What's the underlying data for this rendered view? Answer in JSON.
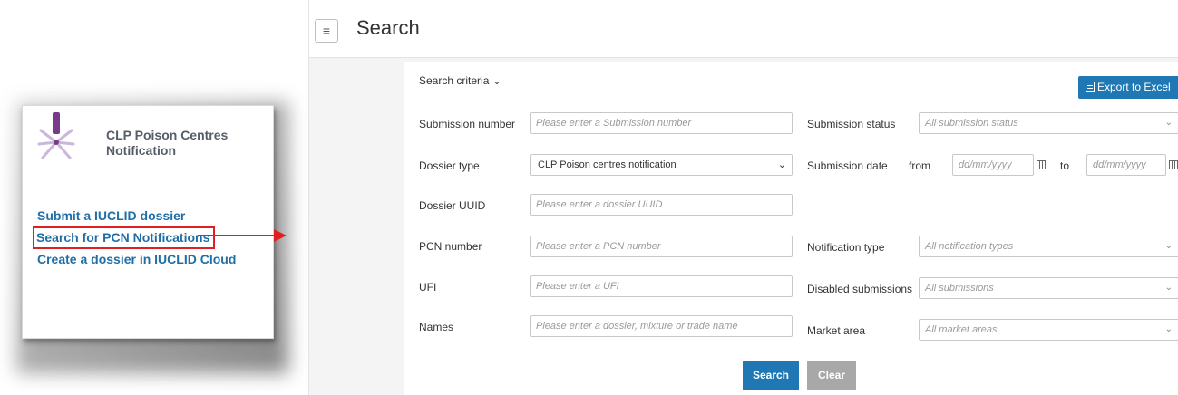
{
  "card": {
    "title": "CLP Poison Centres Notification",
    "links": [
      {
        "label": "Submit a IUCLID dossier"
      },
      {
        "label": "Search for PCN Notifications"
      },
      {
        "label": "Create a dossier in IUCLID Cloud"
      }
    ]
  },
  "header": {
    "title": "Search"
  },
  "search": {
    "criteria_label": "Search criteria",
    "export_label": "Export to Excel",
    "fields": {
      "submission_number": {
        "label": "Submission number",
        "placeholder": "Please enter a Submission number"
      },
      "submission_status": {
        "label": "Submission status",
        "value": "All submission status"
      },
      "dossier_type": {
        "label": "Dossier type",
        "value": "CLP Poison centres notification"
      },
      "submission_date": {
        "label": "Submission date",
        "from_label": "from",
        "to_label": "to",
        "from_placeholder": "dd/mm/yyyy",
        "to_placeholder": "dd/mm/yyyy"
      },
      "dossier_uuid": {
        "label": "Dossier UUID",
        "placeholder": "Please enter a dossier UUID"
      },
      "pcn_number": {
        "label": "PCN number",
        "placeholder": "Please enter a PCN number"
      },
      "notification_type": {
        "label": "Notification type",
        "value": "All notification types"
      },
      "ufi": {
        "label": "UFI",
        "placeholder": "Please enter a UFI"
      },
      "disabled_submissions": {
        "label": "Disabled submissions",
        "value": "All submissions"
      },
      "names": {
        "label": "Names",
        "placeholder": "Please enter a dossier, mixture or trade name"
      },
      "market_area": {
        "label": "Market area",
        "value": "All market areas"
      }
    },
    "search_button": "Search",
    "clear_button": "Clear"
  },
  "colors": {
    "accent": "#1f78b4",
    "link": "#1f6fa6",
    "highlight": "#e02020",
    "logo_purple": "#7a3a8c"
  }
}
